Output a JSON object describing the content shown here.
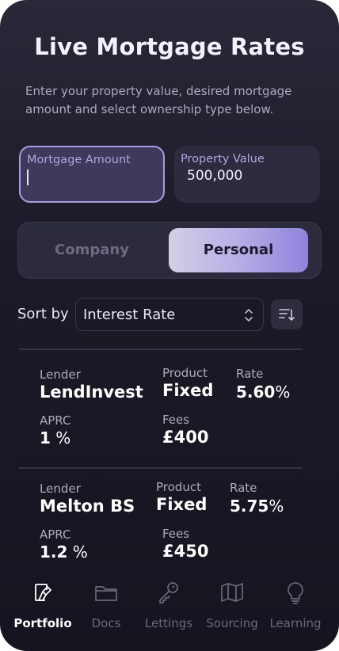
{
  "header": {
    "title": "Live Mortgage Rates",
    "intro": "Enter your property value, desired mortgage amount and select ownership type below."
  },
  "form": {
    "mortgage_label": "Mortgage Amount",
    "mortgage_value": "",
    "property_label": "Property Value",
    "property_value": "500,000"
  },
  "ownership": {
    "options": [
      "Company",
      "Personal"
    ],
    "selected": "Personal"
  },
  "sort": {
    "label": "Sort by",
    "selected": "Interest Rate"
  },
  "results": [
    {
      "lender_label": "Lender",
      "lender": "LendInvest",
      "product_label": "Product",
      "product": "Fixed",
      "rate_label": "Rate",
      "rate_value": "5.60",
      "rate_unit": "%",
      "aprc_label": "APRC",
      "aprc_value": "1",
      "aprc_unit": "%",
      "fees_label": "Fees",
      "fees": "£400"
    },
    {
      "lender_label": "Lender",
      "lender": "Melton BS",
      "product_label": "Product",
      "product": "Fixed",
      "rate_label": "Rate",
      "rate_value": "5.75",
      "rate_unit": "%",
      "aprc_label": "APRC",
      "aprc_value": "1.2",
      "aprc_unit": "%",
      "fees_label": "Fees",
      "fees": "£450"
    }
  ],
  "nav": {
    "items": [
      {
        "label": "Portfolio",
        "icon": "portfolio-icon",
        "active": true
      },
      {
        "label": "Docs",
        "icon": "folder-icon",
        "active": false
      },
      {
        "label": "Lettings",
        "icon": "key-icon",
        "active": false
      },
      {
        "label": "Sourcing",
        "icon": "map-icon",
        "active": false
      },
      {
        "label": "Learning",
        "icon": "lightbulb-icon",
        "active": false
      }
    ]
  },
  "colors": {
    "background": "#1c1a28",
    "accent": "#a89ce0",
    "toggle_active_start": "#d4cfe6",
    "toggle_active_end": "#8f82dc",
    "muted_text": "#aeaabc"
  }
}
